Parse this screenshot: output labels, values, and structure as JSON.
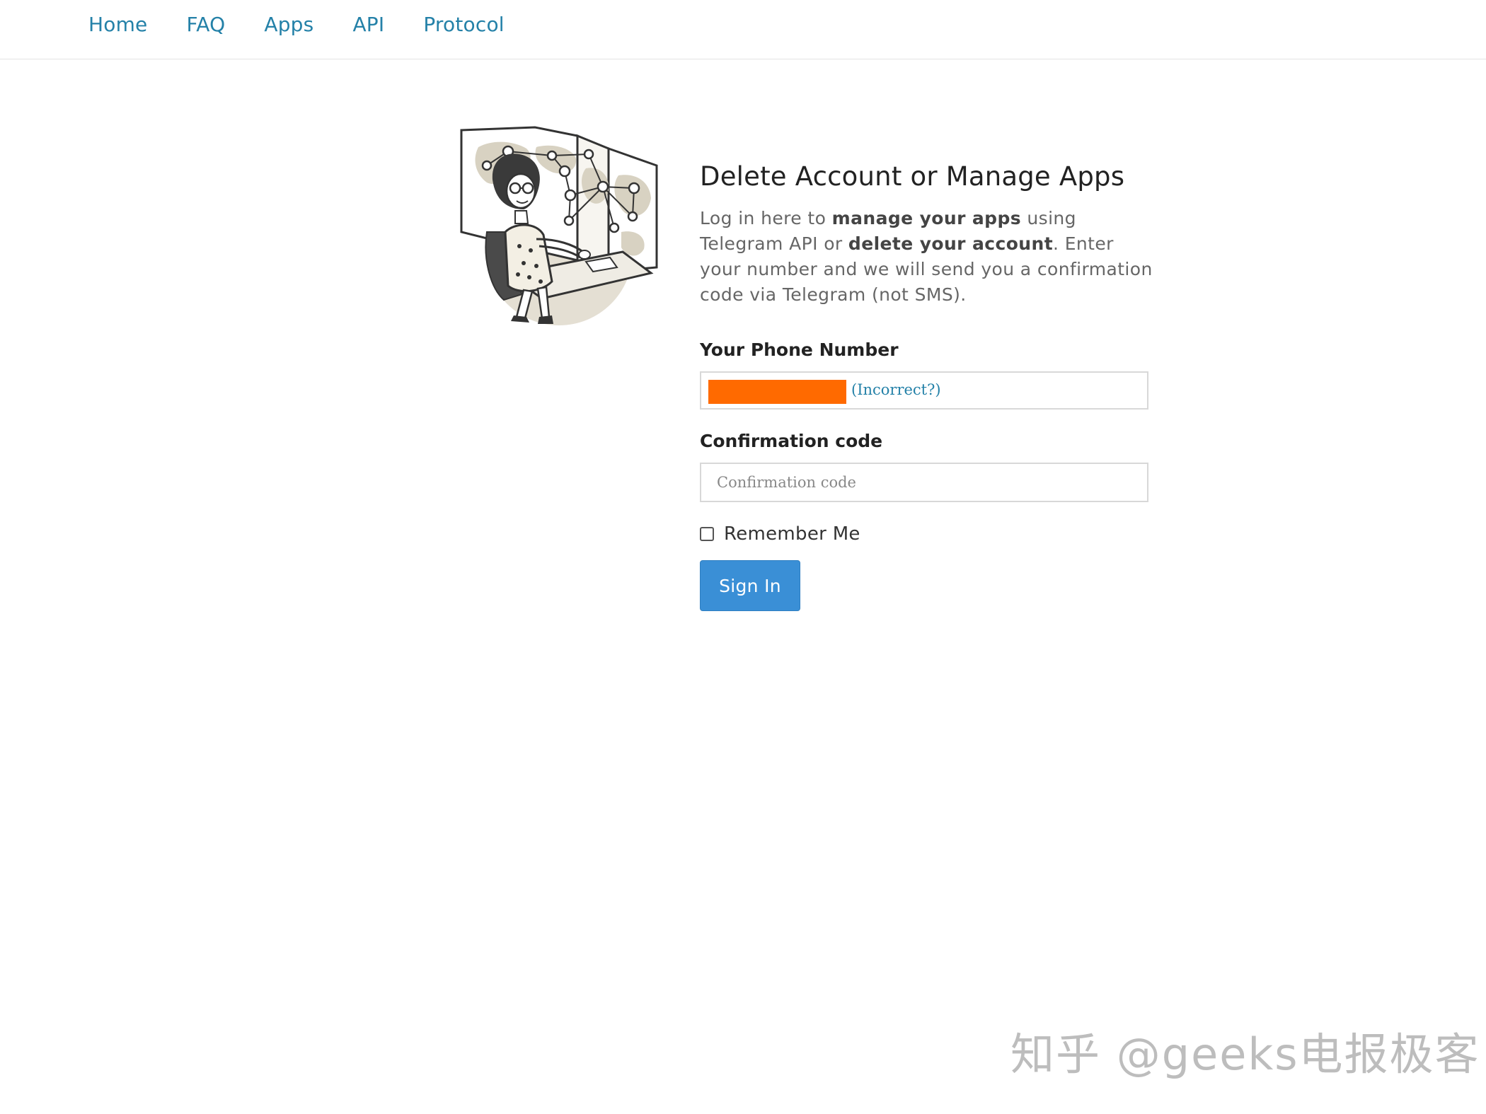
{
  "nav": {
    "items": [
      "Home",
      "FAQ",
      "Apps",
      "API",
      "Protocol"
    ]
  },
  "main": {
    "title": "Delete Account or Manage Apps",
    "description": {
      "part1": "Log in here to ",
      "bold1": "manage your apps",
      "part2": " using Telegram API or ",
      "bold2": "delete your account",
      "part3": ". Enter your number and we will send you a confirmation code via Telegram (not SMS)."
    },
    "phone_label": "Your Phone Number",
    "phone_incorrect_link": "(Incorrect?)",
    "code_label": "Confirmation code",
    "code_placeholder": "Confirmation code",
    "remember_label": "Remember Me",
    "signin_label": "Sign In"
  },
  "watermark": "知乎 @geeks电报极客",
  "colors": {
    "link": "#2481a8",
    "button": "#3a8fd6",
    "redaction": "#ff6a00"
  }
}
